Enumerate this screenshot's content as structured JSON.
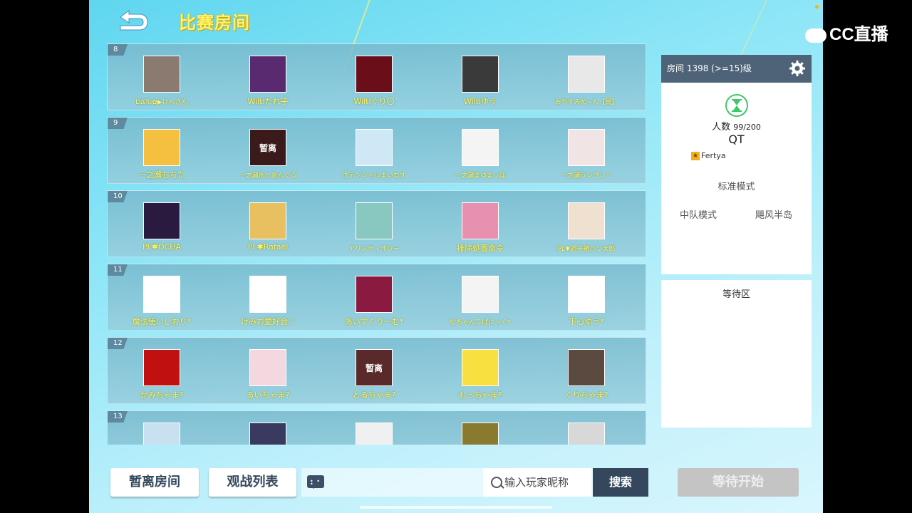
{
  "header": {
    "title": "比赛房间"
  },
  "watermark": {
    "brand": "CC直播"
  },
  "team_rows": [
    {
      "num": "8",
      "players": [
        {
          "name": "DΔTu✿▶けんさん",
          "small": true,
          "avatar_color": "#8a7a70",
          "avatar_text": ""
        },
        {
          "name": "Wiltlたれ子",
          "small": false,
          "avatar_color": "#5a2a70",
          "avatar_text": ""
        },
        {
          "name": "Wiltlぐり〇",
          "small": false,
          "avatar_color": "#6a0f1a",
          "avatar_text": ""
        },
        {
          "name": "Wiltlゆう",
          "small": false,
          "avatar_color": "#3a3a3a",
          "avatar_text": ""
        },
        {
          "name": "おやすみめ~ん【冥】",
          "small": true,
          "avatar_color": "#e8e8e8",
          "avatar_text": ""
        }
      ]
    },
    {
      "num": "9",
      "players": [
        {
          "name": "一之瀬もちた",
          "small": false,
          "avatar_color": "#f5c040",
          "avatar_text": ""
        },
        {
          "name": "一之瀬あとあんぐる",
          "small": true,
          "avatar_color": "#3a1a1a",
          "avatar_text": "暂离"
        },
        {
          "name": "ポテンシャルまいなす",
          "small": true,
          "avatar_color": "#cfe8f5",
          "avatar_text": ""
        },
        {
          "name": "一之瀬まゆまっぽ",
          "small": true,
          "avatar_color": "#f4f4f4",
          "avatar_text": ""
        },
        {
          "name": "一之瀬ランクレー",
          "small": true,
          "avatar_color": "#f0e4e4",
          "avatar_text": ""
        }
      ]
    },
    {
      "num": "10",
      "players": [
        {
          "name": "PL✱OCHA",
          "small": false,
          "avatar_color": "#2a1a40",
          "avatar_text": ""
        },
        {
          "name": "PL✱Rafael",
          "small": false,
          "avatar_color": "#e8c060",
          "avatar_text": ""
        },
        {
          "name": "アリスティオウー",
          "small": true,
          "avatar_color": "#88c8c0",
          "avatar_text": ""
        },
        {
          "name": "排除処置命令",
          "small": false,
          "avatar_color": "#e890b0",
          "avatar_text": ""
        },
        {
          "name": "PL✱週子撒さつ太郎",
          "small": true,
          "avatar_color": "#f0e0d0",
          "avatar_text": ""
        }
      ]
    },
    {
      "num": "11",
      "players": [
        {
          "name": "魔法使いしおり*",
          "small": false,
          "avatar_color": "#ffffff",
          "avatar_text": ""
        },
        {
          "name": "けみお愛好会♡",
          "small": false,
          "avatar_color": "#ffffff",
          "avatar_text": ""
        },
        {
          "name": "あいすくりーむ*",
          "small": false,
          "avatar_color": "#8a1a40",
          "avatar_text": ""
        },
        {
          "name": "むちゃんこばにっく*",
          "small": true,
          "avatar_color": "#f4f4f4",
          "avatar_text": ""
        },
        {
          "name": "下心ゆう*",
          "small": false,
          "avatar_color": "#ffffff",
          "avatar_text": ""
        }
      ]
    },
    {
      "num": "12",
      "players": [
        {
          "name": "かみちゃま?",
          "small": false,
          "avatar_color": "#c01010",
          "avatar_text": ""
        },
        {
          "name": "るいちゃま?",
          "small": false,
          "avatar_color": "#f4d8e0",
          "avatar_text": ""
        },
        {
          "name": "とるちゃま?",
          "small": false,
          "avatar_color": "#5a2a2a",
          "avatar_text": "暂离"
        },
        {
          "name": "むぅちゃま?",
          "small": false,
          "avatar_color": "#f8e040",
          "avatar_text": ""
        },
        {
          "name": "くりちゃま?",
          "small": false,
          "avatar_color": "#5a4a40",
          "avatar_text": ""
        }
      ]
    },
    {
      "num": "13",
      "players": [
        {
          "name": "",
          "small": false,
          "avatar_color": "#c8e0f0",
          "avatar_text": ""
        },
        {
          "name": "",
          "small": false,
          "avatar_color": "#3a3a60",
          "avatar_text": ""
        },
        {
          "name": "",
          "small": false,
          "avatar_color": "#f0f0f0",
          "avatar_text": ""
        },
        {
          "name": "",
          "small": false,
          "avatar_color": "#8a7a30",
          "avatar_text": ""
        },
        {
          "name": "",
          "small": false,
          "avatar_color": "#d8d8d8",
          "avatar_text": ""
        }
      ]
    }
  ],
  "room": {
    "header": "房间 1398 (>=15)级",
    "count_label": "人数",
    "count_value": "99/200",
    "name": "QT",
    "owner": "Fertya",
    "mode_standard": "标准模式",
    "mode_team": "中队模式",
    "mode_island": "飓风半岛",
    "waiting_area": "等待区"
  },
  "bottom": {
    "away_room": "暂离房间",
    "spectate_list": "观战列表",
    "search_placeholder": "输入玩家昵称",
    "search_label": "搜索",
    "wait_start": "等待开始"
  },
  "colors": {
    "accent_yellow": "#fff36a",
    "panel_dark": "#34475d",
    "owner_star": "#f0b020"
  },
  "icons": {
    "back": "back-arrow-icon",
    "settings": "gear-icon",
    "waiting": "hourglass-icon",
    "chat": "chat-icon",
    "search": "search-icon"
  }
}
